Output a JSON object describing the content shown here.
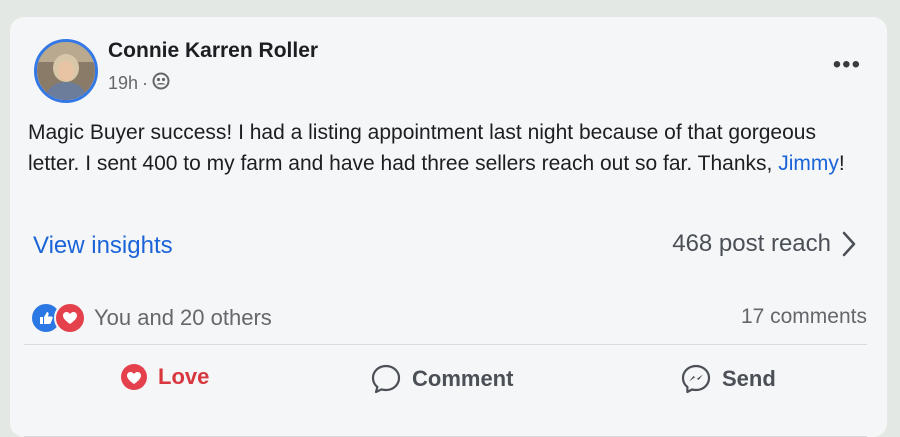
{
  "post": {
    "author": "Connie Karren Roller",
    "time": "19h",
    "separator": "·",
    "audience_icon": "friends-icon",
    "text_main": "Magic Buyer success! I had a listing appointment last night because of that gorgeous letter. I sent 400 to my farm and have had three sellers reach out so far. Thanks, ",
    "mention": "Jimmy",
    "text_end": "!"
  },
  "insights": {
    "link": "View insights",
    "reach": "468 post reach"
  },
  "engagement": {
    "reactions_text": "You and 20 others",
    "comments": "17 comments"
  },
  "actions": {
    "love": "Love",
    "comment": "Comment",
    "send": "Send"
  },
  "colors": {
    "accent": "#1b64d8",
    "love": "#d8373f",
    "like": "#2b78e4"
  }
}
